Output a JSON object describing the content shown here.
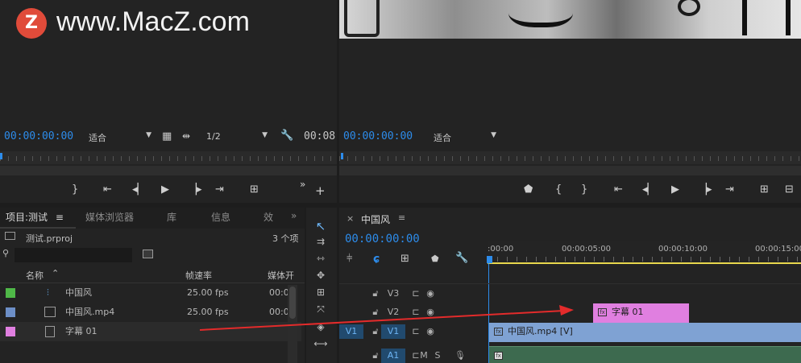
{
  "watermark": {
    "text": "www.MacZ.com",
    "logo_letter": "Z"
  },
  "source_monitor": {
    "timecode_left": "00:00:00:00",
    "fit_label": "适合",
    "resolution": "1/2",
    "timecode_right": "00:08"
  },
  "program_monitor": {
    "timecode": "00:00:00:00",
    "fit_label": "适合"
  },
  "project_panel": {
    "tabs": [
      "项目:测试",
      "媒体浏览器",
      "库",
      "信息",
      "效"
    ],
    "menu_glyph": "≡",
    "overflow_glyph": "»",
    "project_file": "测试.prproj",
    "item_count": "3 个项",
    "columns": {
      "name": "名称",
      "frame_rate": "帧速率",
      "media_start": "媒体开"
    },
    "items": [
      {
        "name": "中国风",
        "fps": "25.00 fps",
        "start": "00:0",
        "color": "#4fb848"
      },
      {
        "name": "中国风.mp4",
        "fps": "25.00 fps",
        "start": "00:0",
        "color": "#6d8fc7"
      },
      {
        "name": "字幕 01",
        "fps": "",
        "start": "",
        "color": "#e07fe0"
      }
    ]
  },
  "timeline": {
    "close_glyph": "×",
    "sequence_name": "中国风",
    "menu_glyph": "≡",
    "timecode": "00:00:00:00",
    "ruler_labels": [
      ":00:00",
      "00:00:05:00",
      "00:00:10:00",
      "00:00:15:00"
    ],
    "tracks": {
      "v3": "V3",
      "v2": "V2",
      "v1_src": "V1",
      "v1": "V1",
      "a1": "A1",
      "mute": "M",
      "solo": "S"
    },
    "clips": {
      "title_clip": "字幕 01",
      "video_clip": "中国风.mp4 [V]",
      "fx": "fx"
    }
  },
  "colors": {
    "accent_blue": "#2d8ceb",
    "title_clip": "#e07fe0",
    "video_clip": "#7fa2d3",
    "arrow_red": "#e32b2b",
    "ruler_yellow": "#e8d74d"
  }
}
